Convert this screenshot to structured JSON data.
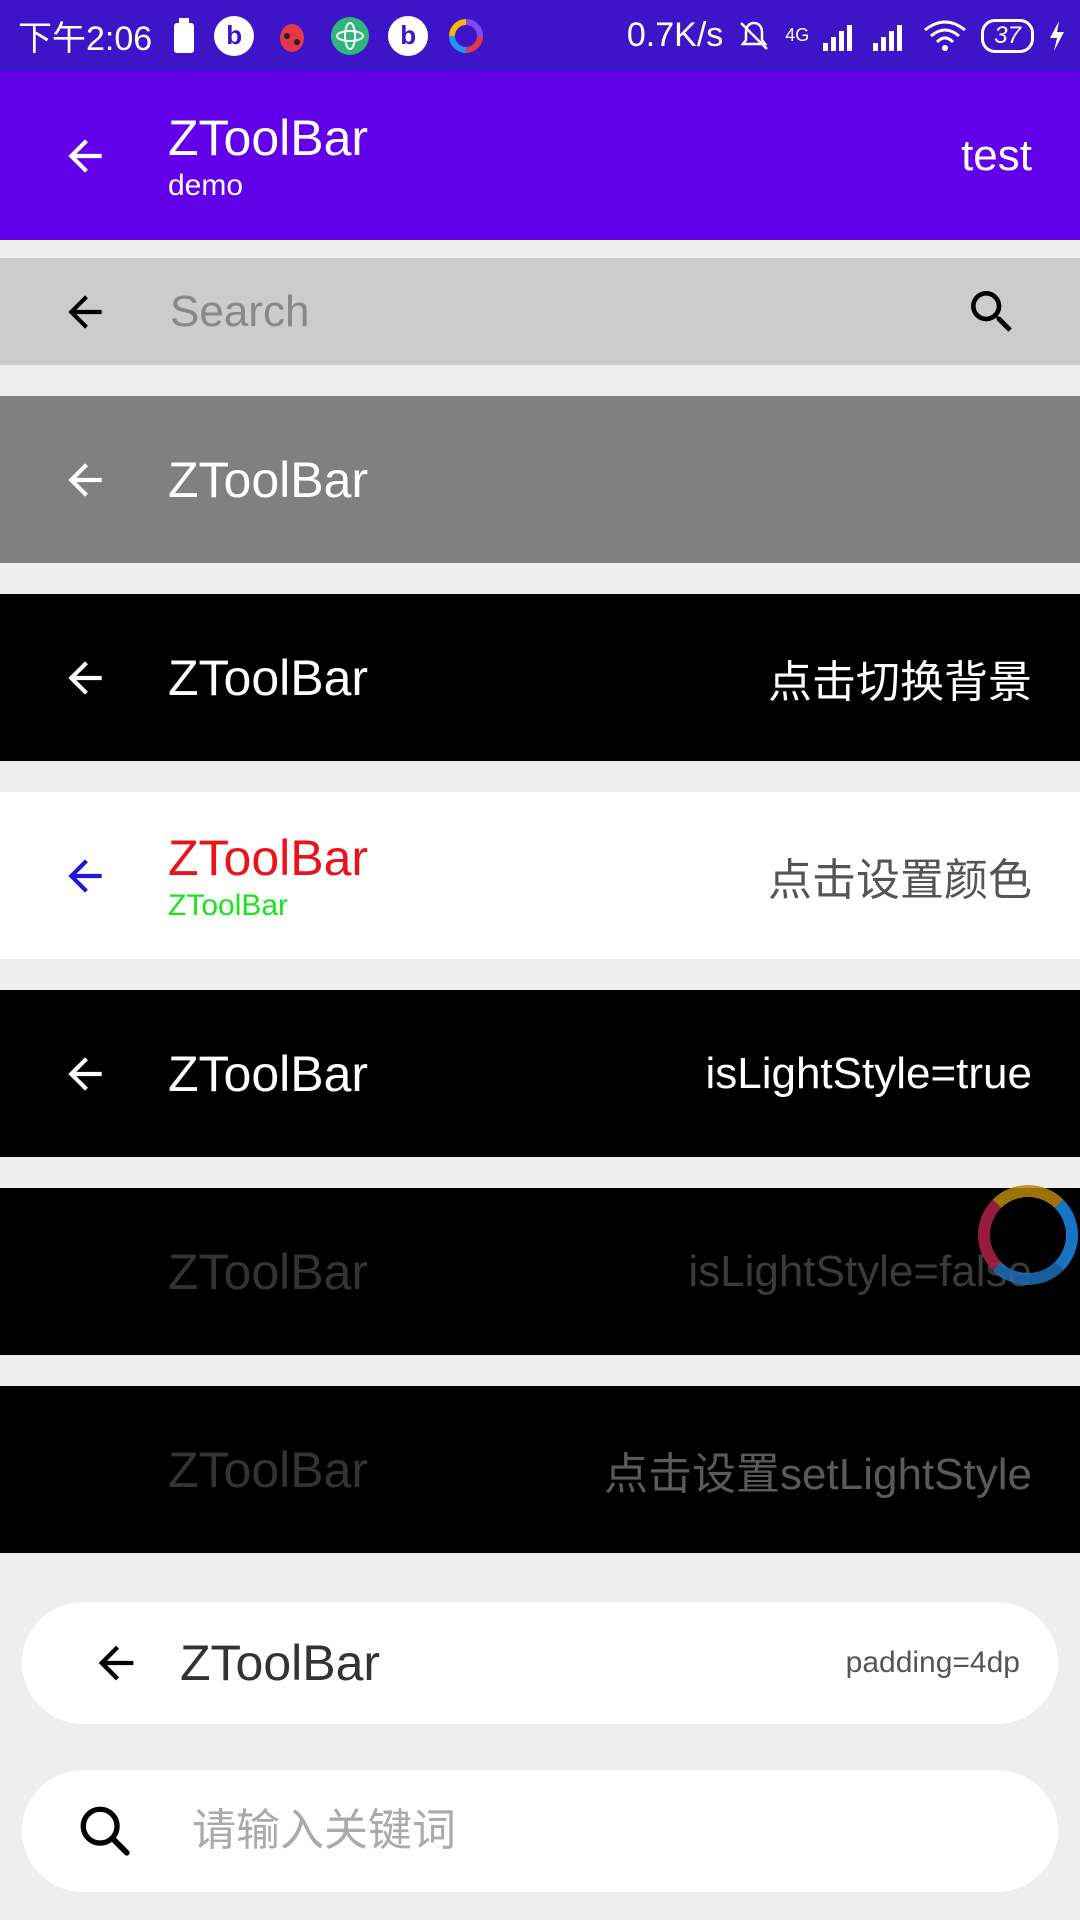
{
  "status_bar": {
    "time": "下午2:06",
    "speed": "0.7K/s",
    "network": "4G",
    "battery": "37",
    "icons": [
      "battery-saver-icon",
      "app-b-icon",
      "bug-icon",
      "atom-icon",
      "app-b-icon",
      "ring-icon",
      "mute-icon",
      "signal-icon",
      "signal-icon",
      "wifi-icon",
      "charging-icon"
    ]
  },
  "toolbars": {
    "main": {
      "title": "ZToolBar",
      "subtitle": "demo",
      "action": "test",
      "bg": "#6200ea"
    },
    "search": {
      "placeholder": "Search",
      "bg": "#cccccc"
    },
    "gray": {
      "title": "ZToolBar",
      "bg": "#808080"
    },
    "black_switch": {
      "title": "ZToolBar",
      "action": "点击切换背景"
    },
    "white_color": {
      "title": "ZToolBar",
      "subtitle": "ZToolBar",
      "action": "点击设置颜色",
      "title_color": "#e8141a",
      "subtitle_color": "#19e619",
      "nav_color": "#1a1ad8"
    },
    "light_true": {
      "title": "ZToolBar",
      "action": "isLightStyle=true"
    },
    "light_false": {
      "title": "ZToolBar",
      "action": "isLightStyle=false"
    },
    "set_light": {
      "title": "ZToolBar",
      "action": "点击设置setLightStyle"
    },
    "padding": {
      "title": "ZToolBar",
      "action": "padding=4dp"
    },
    "keyword_search": {
      "placeholder": "请输入关键词"
    }
  }
}
